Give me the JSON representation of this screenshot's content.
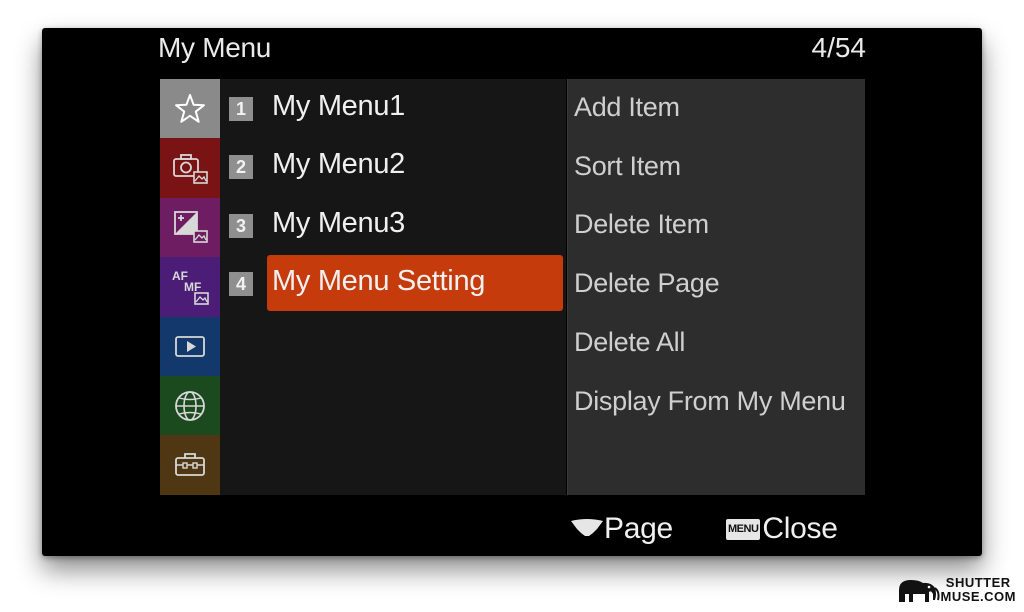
{
  "header": {
    "title": "My Menu",
    "page_indicator": "4/54"
  },
  "tabs": [
    {
      "name": "my-menu",
      "icon": "star-icon",
      "color": "#8a8a8a",
      "selected": true
    },
    {
      "name": "camera",
      "icon": "camera-icon",
      "color": "#7a1414"
    },
    {
      "name": "exposure-color",
      "icon": "exposure-icon",
      "color": "#6e1d63"
    },
    {
      "name": "focus",
      "icon": "af-mf-icon",
      "color": "#4b1d77",
      "text_top": "AF",
      "text_bottom": "MF"
    },
    {
      "name": "playback",
      "icon": "play-icon",
      "color": "#13386b"
    },
    {
      "name": "network",
      "icon": "globe-icon",
      "color": "#1a4a1e"
    },
    {
      "name": "setup",
      "icon": "toolbox-icon",
      "color": "#4f3713"
    }
  ],
  "menu_items": [
    {
      "number": "1",
      "label": "My Menu1"
    },
    {
      "number": "2",
      "label": "My Menu2"
    },
    {
      "number": "3",
      "label": "My Menu3"
    },
    {
      "number": "4",
      "label": "My Menu Setting",
      "selected": true
    }
  ],
  "options": [
    "Add Item",
    "Sort Item",
    "Delete Item",
    "Delete Page",
    "Delete All",
    "Display From My Menu"
  ],
  "footer": {
    "page_label": "Page",
    "menu_key": "MENU",
    "close_label": "Close"
  },
  "colors": {
    "highlight": "#c53b0b",
    "list_bg": "#161616",
    "panel_bg": "#2d2d2d"
  },
  "watermark": {
    "line1": "SHUTTER",
    "line2": "MUSE.COM"
  }
}
